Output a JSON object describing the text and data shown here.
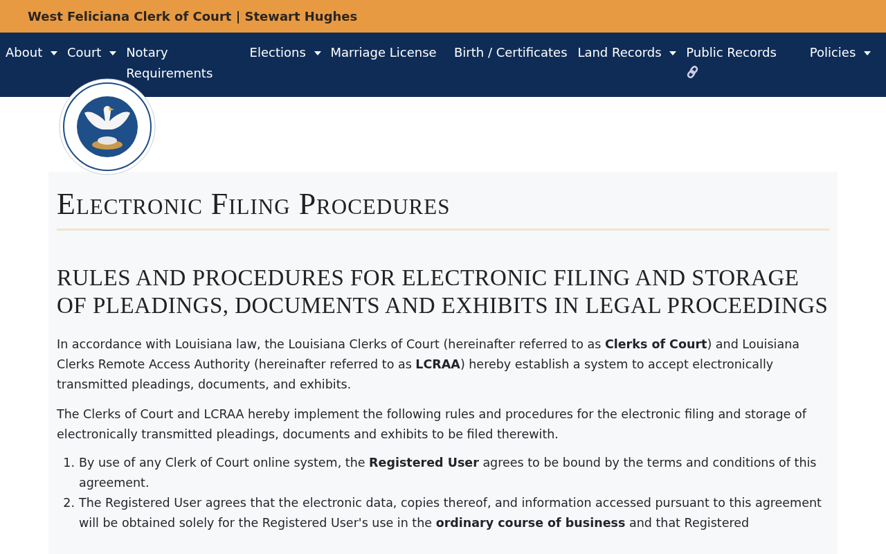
{
  "site_title": "West Feliciana Clerk of Court | Stewart Hughes",
  "nav": [
    {
      "label": "About",
      "dropdown": true,
      "external": false
    },
    {
      "label": "Court",
      "dropdown": true,
      "external": false
    },
    {
      "label": "Notary Requirements",
      "dropdown": false,
      "external": false
    },
    {
      "label": "Elections",
      "dropdown": true,
      "external": false
    },
    {
      "label": "Marriage License",
      "dropdown": false,
      "external": false
    },
    {
      "label": "Birth / Certificates",
      "dropdown": false,
      "external": false
    },
    {
      "label": "Land Records",
      "dropdown": true,
      "external": false
    },
    {
      "label": "Public Records",
      "dropdown": false,
      "external": true
    },
    {
      "label": "Policies",
      "dropdown": true,
      "external": false
    }
  ],
  "page_title": "Electronic Filing Procedures",
  "section_title": "RULES AND PROCEDURES FOR ELECTRONIC FILING AND STORAGE OF PLEADINGS, DOCUMENTS AND EXHIBITS IN LEGAL PROCEEDINGS",
  "paragraphs": [
    "In accordance with Louisiana law, the Louisiana Clerks of Court (hereinafter referred to as **Clerks of Court**) and Louisiana Clerks Remote Access Authority (hereinafter referred to as **LCRAA**) hereby establish a system to accept electronically transmitted pleadings, documents, and exhibits.",
    "The Clerks of Court and LCRAA hereby implement the following rules and procedures for the electronic filing and storage of electronically transmitted pleadings, documents and exhibits to be filed therewith."
  ],
  "rules": [
    {
      "number": "1.",
      "text": "By use of any Clerk of Court online system, the **Registered User** agrees to be bound by the terms and conditions of this agreement."
    },
    {
      "number": "2.",
      "text": "The Registered User agrees that the electronic data, copies thereof, and information accessed pursuant to this agreement will be obtained solely for the Registered User's use in the **ordinary course of business** and that Registered"
    }
  ]
}
